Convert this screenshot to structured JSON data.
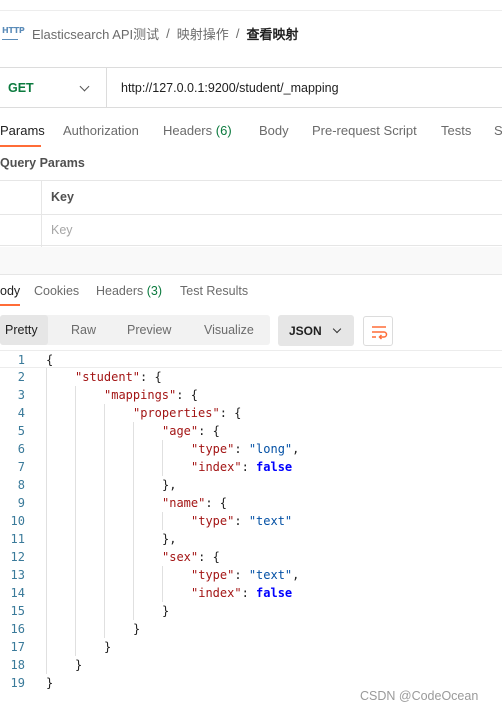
{
  "breadcrumb": {
    "icon": "http-icon",
    "icon_text": "HTTP",
    "collection": "Elasticsearch API测试",
    "sep1": "/",
    "folder": "映射操作",
    "sep2": "/",
    "request": "查看映射"
  },
  "request": {
    "method": "GET",
    "url": "http://127.0.0.1:9200/student/_mapping"
  },
  "request_tabs": [
    {
      "label": "Params",
      "active": true
    },
    {
      "label": "Authorization"
    },
    {
      "label": "Headers",
      "count": "(6)"
    },
    {
      "label": "Body"
    },
    {
      "label": "Pre-request Script"
    },
    {
      "label": "Tests"
    },
    {
      "label": "S"
    }
  ],
  "query_params": {
    "title": "Query Params",
    "key_header": "Key",
    "key_placeholder": "Key"
  },
  "response_tabs": [
    {
      "label": "ody",
      "active": true
    },
    {
      "label": "Cookies"
    },
    {
      "label": "Headers",
      "count": "(3)"
    },
    {
      "label": "Test Results"
    }
  ],
  "view_modes": {
    "active": "Pretty",
    "options": [
      "Pretty",
      "Raw",
      "Preview",
      "Visualize"
    ]
  },
  "format": "JSON",
  "code_lines": [
    {
      "n": "1",
      "indent": 0,
      "parts": [
        [
          "p",
          "{"
        ]
      ]
    },
    {
      "n": "2",
      "indent": 1,
      "parts": [
        [
          "k",
          "\"student\""
        ],
        [
          "p",
          ": {"
        ]
      ]
    },
    {
      "n": "3",
      "indent": 2,
      "parts": [
        [
          "k",
          "\"mappings\""
        ],
        [
          "p",
          ": {"
        ]
      ]
    },
    {
      "n": "4",
      "indent": 3,
      "parts": [
        [
          "k",
          "\"properties\""
        ],
        [
          "p",
          ": {"
        ]
      ]
    },
    {
      "n": "5",
      "indent": 4,
      "parts": [
        [
          "k",
          "\"age\""
        ],
        [
          "p",
          ": {"
        ]
      ]
    },
    {
      "n": "6",
      "indent": 5,
      "parts": [
        [
          "k",
          "\"type\""
        ],
        [
          "p",
          ": "
        ],
        [
          "s",
          "\"long\""
        ],
        [
          "p",
          ","
        ]
      ]
    },
    {
      "n": "7",
      "indent": 5,
      "parts": [
        [
          "k",
          "\"index\""
        ],
        [
          "p",
          ": "
        ],
        [
          "b",
          "false"
        ]
      ]
    },
    {
      "n": "8",
      "indent": 4,
      "parts": [
        [
          "p",
          "},"
        ]
      ]
    },
    {
      "n": "9",
      "indent": 4,
      "parts": [
        [
          "k",
          "\"name\""
        ],
        [
          "p",
          ": {"
        ]
      ]
    },
    {
      "n": "10",
      "indent": 5,
      "parts": [
        [
          "k",
          "\"type\""
        ],
        [
          "p",
          ": "
        ],
        [
          "s",
          "\"text\""
        ]
      ]
    },
    {
      "n": "11",
      "indent": 4,
      "parts": [
        [
          "p",
          "},"
        ]
      ]
    },
    {
      "n": "12",
      "indent": 4,
      "parts": [
        [
          "k",
          "\"sex\""
        ],
        [
          "p",
          ": {"
        ]
      ]
    },
    {
      "n": "13",
      "indent": 5,
      "parts": [
        [
          "k",
          "\"type\""
        ],
        [
          "p",
          ": "
        ],
        [
          "s",
          "\"text\""
        ],
        [
          "p",
          ","
        ]
      ]
    },
    {
      "n": "14",
      "indent": 5,
      "parts": [
        [
          "k",
          "\"index\""
        ],
        [
          "p",
          ": "
        ],
        [
          "b",
          "false"
        ]
      ]
    },
    {
      "n": "15",
      "indent": 4,
      "parts": [
        [
          "p",
          "}"
        ]
      ]
    },
    {
      "n": "16",
      "indent": 3,
      "parts": [
        [
          "p",
          "}"
        ]
      ]
    },
    {
      "n": "17",
      "indent": 2,
      "parts": [
        [
          "p",
          "}"
        ]
      ]
    },
    {
      "n": "18",
      "indent": 1,
      "parts": [
        [
          "p",
          "}"
        ]
      ]
    },
    {
      "n": "19",
      "indent": 0,
      "parts": [
        [
          "p",
          "}"
        ]
      ]
    }
  ],
  "watermark": "CSDN @CodeOcean",
  "colors": {
    "accent": "#ff6c37",
    "method_get": "#0b7a3e",
    "json_key": "#a31515",
    "json_string": "#0451a5",
    "json_keyword": "#0000ff"
  }
}
